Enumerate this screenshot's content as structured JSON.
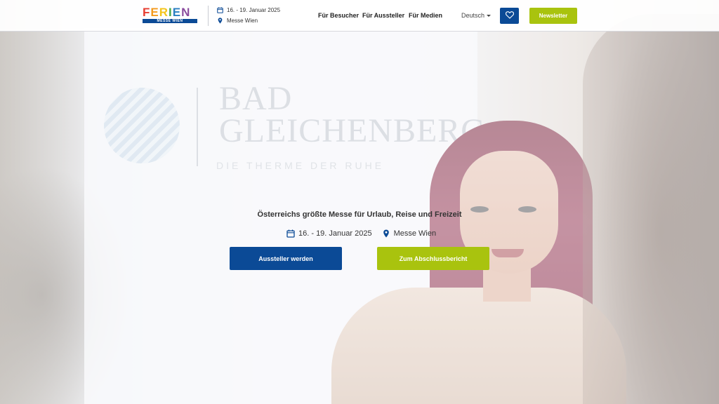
{
  "colors": {
    "brand_blue": "#0b4a96",
    "accent_green": "#a9c30e",
    "logo_letters": [
      "#e63c2f",
      "#f39a1d",
      "#f4c51b",
      "#4aa84a",
      "#2a7fc1",
      "#8a4c9e"
    ]
  },
  "header": {
    "logo": {
      "letters": [
        "F",
        "E",
        "R",
        "I",
        "E",
        "N"
      ],
      "subtitle": "MESSE WIEN"
    },
    "event_date": "16. - 19. Januar 2025",
    "event_location": "Messe Wien",
    "nav": [
      "Für Besucher",
      "Für Aussteller",
      "Für Medien"
    ],
    "language": "Deutsch",
    "favorites_icon": "heart-icon",
    "newsletter_label": "Newsletter"
  },
  "hero": {
    "background_text": {
      "title_line1": "BAD",
      "title_line2": "GLEICHENBERG",
      "subtitle": "DIE THERME DER RUHE"
    },
    "tagline": "Österreichs größte Messe für Urlaub, Reise und Freizeit",
    "date": "16. - 19. Januar 2025",
    "location": "Messe Wien",
    "primary_cta": "Aussteller werden",
    "secondary_cta": "Zum Abschlussbericht"
  }
}
